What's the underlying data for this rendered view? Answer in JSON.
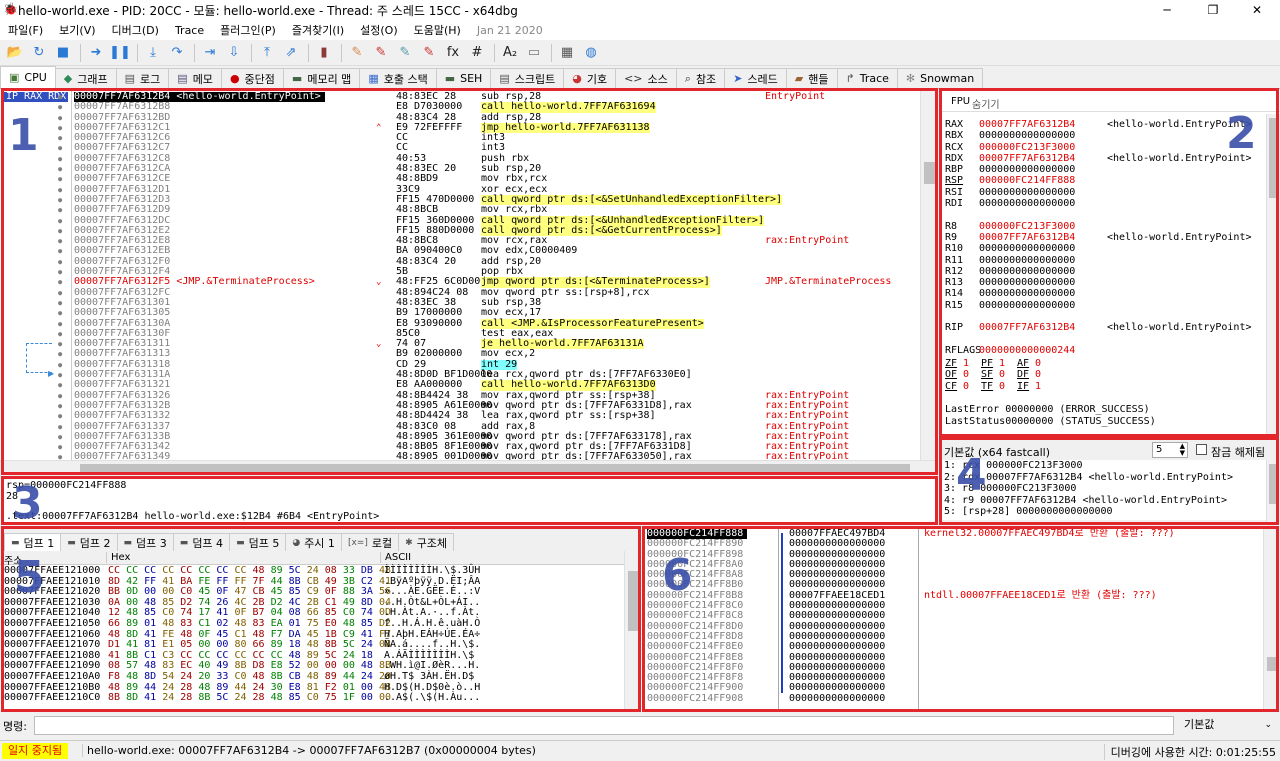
{
  "window": {
    "title": "hello-world.exe - PID: 20CC - 모듈: hello-world.exe - Thread: 주 스레드 15CC - x64dbg",
    "minimize": "─",
    "maximize": "❐",
    "close": "✕"
  },
  "menu": {
    "items": [
      "파일(F)",
      "보기(V)",
      "디버그(D)",
      "Trace",
      "플러그인(P)",
      "즐겨찾기(I)",
      "설정(O)",
      "도움말(H)"
    ],
    "date": "Jan 21 2020"
  },
  "tabs": [
    {
      "label": "CPU",
      "icon": "cpu-icon",
      "glyph": "▣",
      "color": "#4a7a3a"
    },
    {
      "label": "그래프",
      "icon": "graph-icon",
      "glyph": "◆",
      "color": "#2e8b57"
    },
    {
      "label": "로그",
      "icon": "log-icon",
      "glyph": "▤",
      "color": "#555"
    },
    {
      "label": "메모",
      "icon": "notes-icon",
      "glyph": "▤",
      "color": "#557"
    },
    {
      "label": "중단점",
      "icon": "breakpoint-icon",
      "glyph": "●",
      "color": "#c00"
    },
    {
      "label": "메모리 맵",
      "icon": "memory-map-icon",
      "glyph": "▬",
      "color": "#464"
    },
    {
      "label": "호출 스택",
      "icon": "call-stack-icon",
      "glyph": "▦",
      "color": "#36c"
    },
    {
      "label": "SEH",
      "icon": "seh-icon",
      "glyph": "▬",
      "color": "#464"
    },
    {
      "label": "스크립트",
      "icon": "script-icon",
      "glyph": "▤",
      "color": "#555"
    },
    {
      "label": "기호",
      "icon": "symbols-icon",
      "glyph": "◕",
      "color": "#c33"
    },
    {
      "label": "소스",
      "icon": "source-icon",
      "glyph": "<>",
      "color": "#333"
    },
    {
      "label": "참조",
      "icon": "references-icon",
      "glyph": "⌕",
      "color": "#333"
    },
    {
      "label": "스레드",
      "icon": "threads-icon",
      "glyph": "➤",
      "color": "#36c"
    },
    {
      "label": "핸들",
      "icon": "handles-icon",
      "glyph": "▰",
      "color": "#963"
    },
    {
      "label": "Trace",
      "icon": "trace-icon",
      "glyph": "↱",
      "color": "#555"
    },
    {
      "label": "Snowman",
      "icon": "snowman-icon",
      "glyph": "✻",
      "color": "#888"
    }
  ],
  "toolbar": [
    {
      "name": "open-icon",
      "g": "📂",
      "c": "#d9a21b"
    },
    {
      "name": "restart-icon",
      "g": "↻",
      "c": "#2a7ad5"
    },
    {
      "name": "stop-icon",
      "g": "■",
      "c": "#2a7ad5"
    },
    {
      "sep": true
    },
    {
      "name": "run-icon",
      "g": "➜",
      "c": "#2a7ad5"
    },
    {
      "name": "pause-icon",
      "g": "❚❚",
      "c": "#2a7ad5"
    },
    {
      "sep": true
    },
    {
      "name": "step-into-icon",
      "g": "⤓",
      "c": "#2a7ad5"
    },
    {
      "name": "step-over-icon",
      "g": "↷",
      "c": "#2a7ad5"
    },
    {
      "sep": true
    },
    {
      "name": "trace-into-icon",
      "g": "⇥",
      "c": "#2a7ad5"
    },
    {
      "name": "trace-over-icon",
      "g": "⇩",
      "c": "#2a7ad5"
    },
    {
      "sep": true
    },
    {
      "name": "execute-till-return-icon",
      "g": "⤒",
      "c": "#2a7ad5"
    },
    {
      "name": "run-to-user-code-icon",
      "g": "⇗",
      "c": "#2a7ad5"
    },
    {
      "sep": true
    },
    {
      "name": "script-icon",
      "g": "▮",
      "c": "#8b3a3a"
    },
    {
      "sep": true
    },
    {
      "name": "patch-icon",
      "g": "✎",
      "c": "#d98a4a"
    },
    {
      "name": "comment-icon",
      "g": "✎",
      "c": "#c33"
    },
    {
      "name": "label-icon",
      "g": "✎",
      "c": "#59a"
    },
    {
      "name": "bookmark-icon",
      "g": "✎",
      "c": "#c33"
    },
    {
      "name": "function-icon",
      "g": "fx",
      "c": "#222"
    },
    {
      "name": "hash-icon",
      "g": "#",
      "c": "#222"
    },
    {
      "sep": true
    },
    {
      "name": "font-size-icon",
      "g": "A₂",
      "c": "#222"
    },
    {
      "name": "strings-icon",
      "g": "▭",
      "c": "#777"
    },
    {
      "sep": true
    },
    {
      "name": "calculator-icon",
      "g": "▦",
      "c": "#555"
    },
    {
      "name": "globe-icon",
      "g": "◍",
      "c": "#2a7ad5"
    }
  ],
  "disasm": {
    "regheader": "IP RAX RDX",
    "rows": [
      {
        "addr": "00007FF7AF6312B4",
        "label": "<hello-world.EntryPoint>",
        "bytes": "48:83EC 28",
        "ins": "sub rsp,28",
        "cmt": "EntryPoint",
        "sel": true
      },
      {
        "addr": "00007FF7AF6312B8",
        "bytes": "E8 D7030000",
        "ins": "call hello-world.7FF7AF631694",
        "hy": true
      },
      {
        "addr": "00007FF7AF6312BD",
        "bytes": "48:83C4 28",
        "ins": "add rsp,28"
      },
      {
        "addr": "00007FF7AF6312C1",
        "bytes": "E9 72FEFFFF",
        "ins": "jmp hello-world.7FF7AF631138",
        "jy": true,
        "mark": "^"
      },
      {
        "addr": "00007FF7AF6312C6",
        "bytes": "CC",
        "ins": "int3"
      },
      {
        "addr": "00007FF7AF6312C7",
        "bytes": "CC",
        "ins": "int3"
      },
      {
        "addr": "00007FF7AF6312C8",
        "bytes": "40:53",
        "ins": "push rbx"
      },
      {
        "addr": "00007FF7AF6312CA",
        "bytes": "48:83EC 20",
        "ins": "sub rsp,20"
      },
      {
        "addr": "00007FF7AF6312CE",
        "bytes": "48:8BD9",
        "ins": "mov rbx,rcx"
      },
      {
        "addr": "00007FF7AF6312D1",
        "bytes": "33C9",
        "ins": "xor ecx,ecx"
      },
      {
        "addr": "00007FF7AF6312D3",
        "bytes": "FF15 470D0000",
        "ins": "call qword ptr ds:[<&SetUnhandledExceptionFilter>]",
        "hy": true
      },
      {
        "addr": "00007FF7AF6312D9",
        "bytes": "48:8BCB",
        "ins": "mov rcx,rbx"
      },
      {
        "addr": "00007FF7AF6312DC",
        "bytes": "FF15 360D0000",
        "ins": "call qword ptr ds:[<&UnhandledExceptionFilter>]",
        "hy": true
      },
      {
        "addr": "00007FF7AF6312E2",
        "bytes": "FF15 880D0000",
        "ins": "call qword ptr ds:[<&GetCurrentProcess>]",
        "hy": true
      },
      {
        "addr": "00007FF7AF6312E8",
        "bytes": "48:8BC8",
        "ins": "mov rcx,rax",
        "cmt": "rax:EntryPoint"
      },
      {
        "addr": "00007FF7AF6312EB",
        "bytes": "BA 090400C0",
        "ins": "mov edx,C0000409"
      },
      {
        "addr": "00007FF7AF6312F0",
        "bytes": "48:83C4 20",
        "ins": "add rsp,20"
      },
      {
        "addr": "00007FF7AF6312F4",
        "bytes": "5B",
        "ins": "pop rbx"
      },
      {
        "addr": "00007FF7AF6312F5",
        "label": "<JMP.&TerminateProcess>",
        "bytes": "48:FF25 6C0D0000",
        "ins": "jmp qword ptr ds:[<&TerminateProcess>]",
        "jy": true,
        "cmt": "JMP.&TerminateProcess",
        "redaddr": true,
        "mark": "v"
      },
      {
        "addr": "00007FF7AF6312FC",
        "bytes": "48:894C24 08",
        "ins": "mov qword ptr ss:[rsp+8],rcx"
      },
      {
        "addr": "00007FF7AF631301",
        "bytes": "48:83EC 38",
        "ins": "sub rsp,38"
      },
      {
        "addr": "00007FF7AF631305",
        "bytes": "B9 17000000",
        "ins": "mov ecx,17"
      },
      {
        "addr": "00007FF7AF63130A",
        "bytes": "E8 93090000",
        "ins": "call <JMP.&IsProcessorFeaturePresent>",
        "hy": true
      },
      {
        "addr": "00007FF7AF63130F",
        "bytes": "85C0",
        "ins": "test eax,eax"
      },
      {
        "addr": "00007FF7AF631311",
        "bytes": "74 07",
        "ins": "je hello-world.7FF7AF63131A",
        "jy": true,
        "mark": "v"
      },
      {
        "addr": "00007FF7AF631313",
        "bytes": "B9 02000000",
        "ins": "mov ecx,2"
      },
      {
        "addr": "00007FF7AF631318",
        "bytes": "CD 29",
        "ins": "int 29",
        "hc": true
      },
      {
        "addr": "00007FF7AF63131A",
        "bytes": "48:8D0D BF1D0000",
        "ins": "lea rcx,qword ptr ds:[7FF7AF6330E0]"
      },
      {
        "addr": "00007FF7AF631321",
        "bytes": "E8 AA000000",
        "ins": "call hello-world.7FF7AF6313D0",
        "hy": true
      },
      {
        "addr": "00007FF7AF631326",
        "bytes": "48:8B4424 38",
        "ins": "mov rax,qword ptr ss:[rsp+38]",
        "cmt": "rax:EntryPoint"
      },
      {
        "addr": "00007FF7AF63132B",
        "bytes": "48:8905 A61E0000",
        "ins": "mov qword ptr ds:[7FF7AF6331D8],rax",
        "cmt": "rax:EntryPoint"
      },
      {
        "addr": "00007FF7AF631332",
        "bytes": "48:8D4424 38",
        "ins": "lea rax,qword ptr ss:[rsp+38]",
        "cmt": "rax:EntryPoint"
      },
      {
        "addr": "00007FF7AF631337",
        "bytes": "48:83C0 08",
        "ins": "add rax,8",
        "cmt": "rax:EntryPoint"
      },
      {
        "addr": "00007FF7AF63133B",
        "bytes": "48:8905 361E0000",
        "ins": "mov qword ptr ds:[7FF7AF633178],rax",
        "cmt": "rax:EntryPoint"
      },
      {
        "addr": "00007FF7AF631342",
        "bytes": "48:8B05 8F1E0000",
        "ins": "mov rax,qword ptr ds:[7FF7AF6331D8]",
        "cmt": "rax:EntryPoint"
      },
      {
        "addr": "00007FF7AF631349",
        "bytes": "48:8905 001D0000",
        "ins": "mov qword ptr ds:[7FF7AF633050],rax",
        "cmt": "rax:EntryPoint"
      }
    ]
  },
  "registers": {
    "tab_fpu": "FPU",
    "tab_hide": "숨기기",
    "rows": [
      {
        "n": "RAX",
        "v": "00007FF7AF6312B4",
        "c": "<hello-world.EntryPoint>",
        "red": true
      },
      {
        "n": "RBX",
        "v": "0000000000000000"
      },
      {
        "n": "RCX",
        "v": "000000FC213F3000",
        "red": true
      },
      {
        "n": "RDX",
        "v": "00007FF7AF6312B4",
        "c": "<hello-world.EntryPoint>",
        "red": true
      },
      {
        "n": "RBP",
        "v": "0000000000000000"
      },
      {
        "n": "RSP",
        "v": "000000FC214FF888",
        "red": true,
        "u": true
      },
      {
        "n": "RSI",
        "v": "0000000000000000"
      },
      {
        "n": "RDI",
        "v": "0000000000000000"
      },
      {
        "n": "",
        "v": ""
      },
      {
        "n": "R8",
        "v": "000000FC213F3000",
        "red": true
      },
      {
        "n": "R9",
        "v": "00007FF7AF6312B4",
        "c": "<hello-world.EntryPoint>",
        "red": true
      },
      {
        "n": "R10",
        "v": "0000000000000000"
      },
      {
        "n": "R11",
        "v": "0000000000000000"
      },
      {
        "n": "R12",
        "v": "0000000000000000"
      },
      {
        "n": "R13",
        "v": "0000000000000000"
      },
      {
        "n": "R14",
        "v": "0000000000000000"
      },
      {
        "n": "R15",
        "v": "0000000000000000"
      },
      {
        "n": "",
        "v": ""
      },
      {
        "n": "RIP",
        "v": "00007FF7AF6312B4",
        "c": "<hello-world.EntryPoint>",
        "red": true
      },
      {
        "n": "",
        "v": ""
      },
      {
        "n": "RFLAGS",
        "v": "0000000000000244",
        "red": true
      }
    ],
    "flags": [
      [
        "ZF",
        "1",
        "PF",
        "1",
        "AF",
        "0"
      ],
      [
        "OF",
        "0",
        "SF",
        "0",
        "DF",
        "0"
      ],
      [
        "CF",
        "0",
        "TF",
        "0",
        "IF",
        "1"
      ]
    ],
    "lasterror": "LastError 00000000 (ERROR_SUCCESS)",
    "laststatus": "LastStatus00000000 (STATUS_SUCCESS)"
  },
  "callargs": {
    "convention": "기본값 (x64 fastcall)",
    "count": "5",
    "unlock": "잠금 해제됨",
    "rows": [
      "1: rcx 000000FC213F3000",
      "2: rdx 00007FF7AF6312B4 <hello-world.EntryPoint>",
      "3: r8 000000FC213F3000",
      "4: r9 00007FF7AF6312B4 <hello-world.EntryPoint>",
      "5: [rsp+28] 0000000000000000"
    ]
  },
  "info": {
    "line1": "rsp=000000FC214FF888",
    "line2": "28",
    "line3": ".text:00007FF7AF6312B4 hello-world.exe:$12B4 #6B4 <EntryPoint>"
  },
  "dump": {
    "tabs": [
      "덤프 1",
      "덤프 2",
      "덤프 3",
      "덤프 4",
      "덤프 5",
      "주시 1",
      "로컬",
      "구조체"
    ],
    "col_addr": "주소",
    "col_hex": "Hex",
    "col_ascii": "ASCII",
    "rows": [
      {
        "a": "00007FFAEE121000",
        "h": "CC CC CC CC CC CC CC CC 48 89 5C 24 08 33 DB 48",
        "s": "ÌÌÌÌÌÌÌÌH.\\$.3ÛH"
      },
      {
        "a": "00007FFAEE121010",
        "h": "8D 42 FF 41 BA FE FF FF 7F 44 8B CB 49 3B C2 41",
        "s": ".BÿAºþÿÿ.D.ËI;ÂA"
      },
      {
        "a": "00007FFAEE121020",
        "h": "BB 0D 00 00 C0 45 0F 47 CB 45 85 C9 0F 88 3A 56",
        "s": "»...ÀE.GËE.É..:V"
      },
      {
        "a": "00007FFAEE121030",
        "h": "0A 00 48 85 D2 74 26 4C 2B D2 4C 2B C1 49 8D 04",
        "s": "..H.Òt&L+ÒL+ÁI.."
      },
      {
        "a": "00007FFAEE121040",
        "h": "12 48 85 C0 74 17 41 0F B7 04 08 66 85 C0 74 0D",
        "s": ".H.Àt.A.·..f.Àt."
      },
      {
        "a": "00007FFAEE121050",
        "h": "66 89 01 48 83 C1 02 48 83 EA 01 75 E0 48 85 D2",
        "s": "f..H.Á.H.ê.uàH.Ò"
      },
      {
        "a": "00007FFAEE121060",
        "h": "48 8D 41 FE 48 0F 45 C1 48 F7 DA 45 1B C9 41 F7",
        "s": "H.AþH.EÁH÷ÚE.ÉA÷"
      },
      {
        "a": "00007FFAEE121070",
        "h": "D1 41 81 E1 05 00 00 80 66 89 18 48 8B 5C 24 08",
        "s": "ÑA.á....f..H.\\$."
      },
      {
        "a": "00007FFAEE121080",
        "h": "41 8B C1 C3 CC CC CC CC CC CC 48 89 5C 24 18",
        "s": "A.ÁÃÌÌÌÌÌÌÌH.\\$"
      },
      {
        "a": "00007FFAEE121090",
        "h": "08 57 48 83 EC 40 49 8B D8 E8 52 00 00 00 48 8B",
        "s": ".WH.ì@I.ØèR...H."
      },
      {
        "a": "00007FFAEE1210A0",
        "h": "F8 48 8D 54 24 20 33 C0 48 8B CB 48 89 44 24 20",
        "s": "øH.T$ 3ÀH.ËH.D$ "
      },
      {
        "a": "00007FFAEE1210B0",
        "h": "48 89 44 24 28 48 89 44 24 30 E8 81 F2 01 00 48",
        "s": "H.D$(H.D$0è.ò..H"
      },
      {
        "a": "00007FFAEE1210C0",
        "h": "8B 8D 41 24 28 8B 5C 24 28 48 85 C0 75 1F 00 00",
        "s": "..A$(.\\$(H.Àu..."
      }
    ]
  },
  "stack": {
    "rows": [
      {
        "a": "000000FC214FF888",
        "v": "00007FFAEC497BD4",
        "c": "kernel32.00007FFAEC497BD4로 반환 (출발: ???)",
        "sel": true,
        "red": true
      },
      {
        "a": "000000FC214FF890",
        "v": "0000000000000000"
      },
      {
        "a": "000000FC214FF898",
        "v": "0000000000000000"
      },
      {
        "a": "000000FC214FF8A0",
        "v": "0000000000000000"
      },
      {
        "a": "000000FC214FF8A8",
        "v": "0000000000000000"
      },
      {
        "a": "000000FC214FF8B0",
        "v": "0000000000000000"
      },
      {
        "a": "000000FC214FF8B8",
        "v": "00007FFAEE18CED1",
        "c": "ntdll.00007FFAEE18CED1로 반환 (출발: ???)",
        "red": true
      },
      {
        "a": "000000FC214FF8C0",
        "v": "0000000000000000"
      },
      {
        "a": "000000FC214FF8C8",
        "v": "0000000000000000"
      },
      {
        "a": "000000FC214FF8D0",
        "v": "0000000000000000"
      },
      {
        "a": "000000FC214FF8D8",
        "v": "0000000000000000"
      },
      {
        "a": "000000FC214FF8E0",
        "v": "0000000000000000"
      },
      {
        "a": "000000FC214FF8E8",
        "v": "0000000000000000"
      },
      {
        "a": "000000FC214FF8F0",
        "v": "0000000000000000"
      },
      {
        "a": "000000FC214FF8F8",
        "v": "0000000000000000"
      },
      {
        "a": "000000FC214FF900",
        "v": "0000000000000000"
      },
      {
        "a": "000000FC214FF908",
        "v": "0000000000000000"
      }
    ]
  },
  "command": {
    "label": "명령:",
    "value": "",
    "mode": "기본값"
  },
  "status": {
    "state": "일지 중지됨",
    "message": "hello-world.exe: 00007FF7AF6312B4 -> 00007FF7AF6312B7 (0x00000004 bytes)",
    "time": "디버깅에 사용한 시간: 0:01:25:55"
  },
  "annotations": [
    "1",
    "2",
    "3",
    "4",
    "5",
    "6"
  ],
  "colors": {
    "accent": "#e2262c",
    "label": "#3a4ea8",
    "selection": "#000000",
    "highlight": "#ffff80",
    "status_state": "#ffff00"
  }
}
